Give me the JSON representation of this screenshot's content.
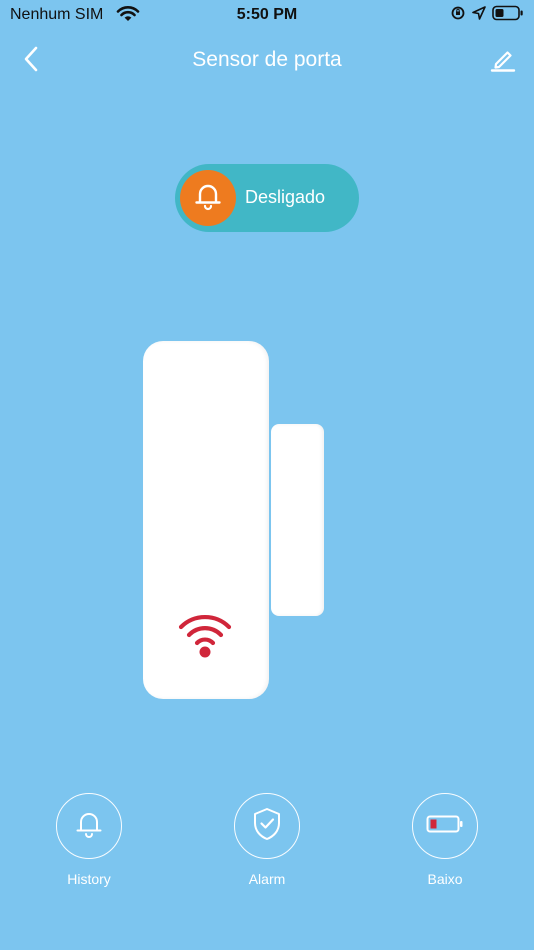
{
  "status_bar": {
    "carrier": "Nenhum SIM",
    "time": "5:50 PM"
  },
  "header": {
    "title": "Sensor de porta",
    "back_icon": "chevron-left-icon",
    "edit_icon": "pencil-icon"
  },
  "alarm_toggle": {
    "label": "Desligado",
    "icon": "bell-icon",
    "pill_color": "#41B7C6",
    "knob_color": "#EE7B1F"
  },
  "sensor": {
    "signal_icon": "wifi-signal-icon",
    "signal_color": "#D0263A"
  },
  "actions": [
    {
      "label": "History",
      "icon": "bell-icon"
    },
    {
      "label": "Alarm",
      "icon": "shield-check-icon"
    },
    {
      "label": "Baixo",
      "icon": "battery-low-icon"
    }
  ],
  "colors": {
    "background": "#7CC5EF",
    "text": "#FFFFFF"
  }
}
